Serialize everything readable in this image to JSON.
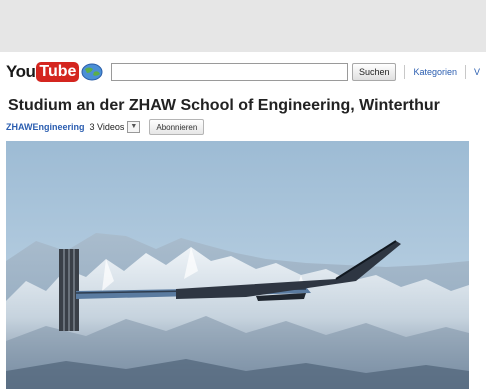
{
  "header": {
    "logo_you": "You",
    "logo_tube": "Tube",
    "search_value": "",
    "search_button": "Suchen",
    "nav_categories": "Kategorien",
    "nav_more": "V"
  },
  "video": {
    "title": "Studium an der ZHAW School of Engineering, Winterthur",
    "channel": "ZHAWEngineering",
    "video_count": "3 Videos",
    "subscribe_label": "Abonnieren"
  },
  "colors": {
    "page_bg": "#e6e6e6",
    "link": "#2a5db0",
    "logo_red": "#d4251f"
  }
}
